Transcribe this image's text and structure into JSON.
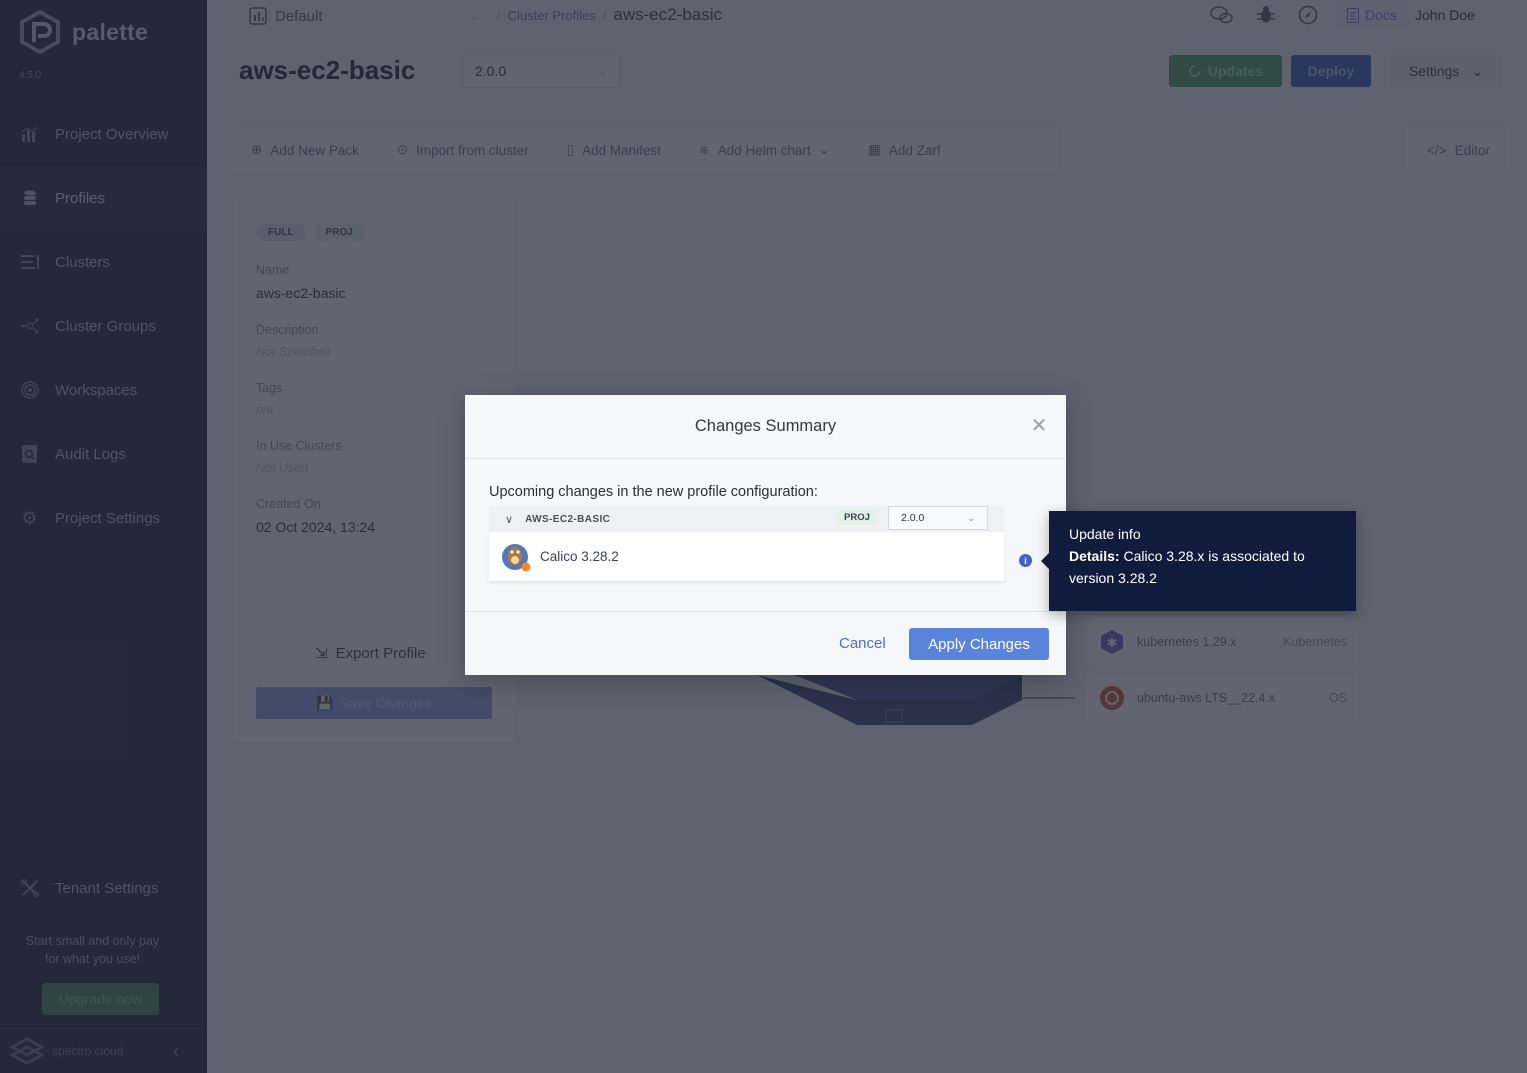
{
  "app": {
    "name": "palette",
    "version": "4.5.0"
  },
  "sidebar": {
    "items": [
      {
        "label": "Project Overview",
        "icon": "chart-icon"
      },
      {
        "label": "Profiles",
        "icon": "database-stack-icon",
        "active": true
      },
      {
        "label": "Clusters",
        "icon": "clusters-list-icon"
      },
      {
        "label": "Cluster Groups",
        "icon": "network-nodes-icon"
      },
      {
        "label": "Workspaces",
        "icon": "target-icon"
      },
      {
        "label": "Audit Logs",
        "icon": "search-document-icon"
      },
      {
        "label": "Project Settings",
        "icon": "gear-icon"
      }
    ],
    "tenant_settings": "Tenant Settings",
    "promo_line1": "Start small and only pay",
    "promo_line2": "for what you use!",
    "upgrade_label": "Upgrade now",
    "footer_brand": "spectro cloud"
  },
  "topbar": {
    "project": "Default",
    "breadcrumb_link": "Cluster Profiles",
    "breadcrumb_sep": "/",
    "breadcrumb_current": "aws-ec2-basic",
    "docs_label": "Docs",
    "user_name": "John Doe"
  },
  "header": {
    "title": "aws-ec2-basic",
    "version": "2.0.0",
    "updates_label": "Updates",
    "deploy_label": "Deploy",
    "settings_label": "Settings"
  },
  "toolbar": {
    "add_new_pack": "Add New Pack",
    "import_from_cluster": "Import from cluster",
    "add_manifest": "Add Manifest",
    "add_helm_chart": "Add Helm chart",
    "add_zarf": "Add Zarf",
    "editor": "Editor"
  },
  "profile_info": {
    "tags": [
      "FULL",
      "PROJ"
    ],
    "name_label": "Name",
    "name": "aws-ec2-basic",
    "description_label": "Description",
    "description": "Not Specified",
    "tags_label": "Tags",
    "tags_value": "n/a",
    "in_use_label": "In Use Clusters",
    "in_use": "Not Used",
    "created_label": "Created On",
    "created": "02 Oct 2024, 13:24",
    "export_label": "Export Profile",
    "save_label": "Save Changes"
  },
  "layers": [
    {
      "name": "kubernetes 1.29.x",
      "type": "Kubernetes"
    },
    {
      "name": "ubuntu-aws LTS__22.4.x",
      "type": "OS"
    }
  ],
  "modal": {
    "title": "Changes Summary",
    "intro": "Upcoming changes in the new profile configuration:",
    "profile_name": "AWS-EC2-BASIC",
    "profile_scope": "PROJ",
    "profile_version": "2.0.0",
    "pack_name": "Calico 3.28.2",
    "cancel_label": "Cancel",
    "apply_label": "Apply Changes"
  },
  "tooltip": {
    "title": "Update info",
    "details_label": "Details:",
    "details_text": "Calico 3.28.x is associated to version 3.28.2"
  },
  "colors": {
    "sidebar_bg": "#212638",
    "primary": "#5a84db",
    "success": "#4c9e5f",
    "tooltip_bg": "#111c3c"
  }
}
